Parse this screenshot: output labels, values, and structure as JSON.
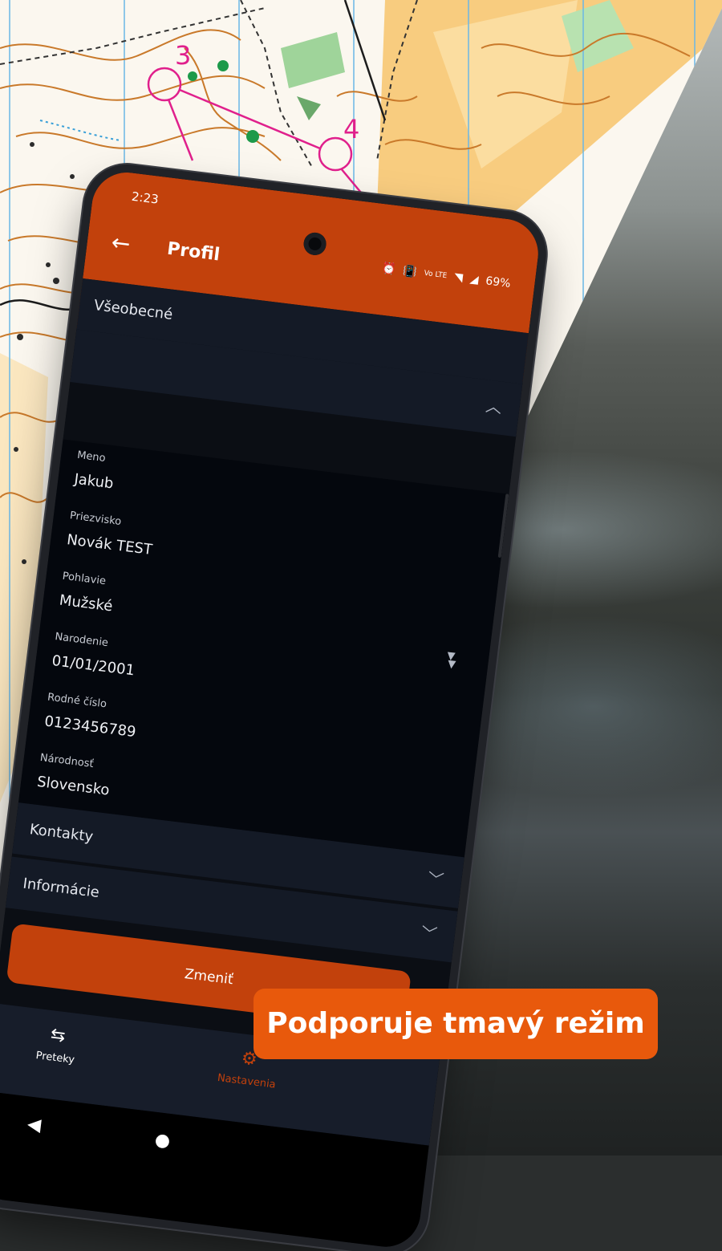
{
  "colors": {
    "accent": "#c2410c",
    "badge": "#e8590c",
    "panel": "#141a26",
    "background_dark": "#04070d"
  },
  "status_bar": {
    "time": "2:23",
    "battery": "69%",
    "network": "Vo LTE"
  },
  "map": {
    "control_3": "3",
    "control_4": "4"
  },
  "appbar": {
    "title": "Profil",
    "back_icon": "arrow-left-icon"
  },
  "sections": {
    "general": "Všeobecné",
    "contacts": "Kontakty",
    "info": "Informácie"
  },
  "fields": [
    {
      "label": "Meno",
      "value": "Jakub"
    },
    {
      "label": "Priezvisko",
      "value": "Novák TEST"
    },
    {
      "label": "Pohlavie",
      "value": "Mužské"
    },
    {
      "label": "Narodenie",
      "value": "01/01/2001"
    },
    {
      "label": "Rodné číslo",
      "value": "0123456789"
    },
    {
      "label": "Národnosť",
      "value": "Slovensko"
    }
  ],
  "buttons": {
    "change": "Zmeniť"
  },
  "bottom_nav": {
    "races": {
      "label": "Preteky",
      "icon": "signpost-icon"
    },
    "settings": {
      "label": "Nastavenia",
      "icon": "gear-icon"
    }
  },
  "promo": {
    "text": "Podporuje tmavý režim"
  }
}
